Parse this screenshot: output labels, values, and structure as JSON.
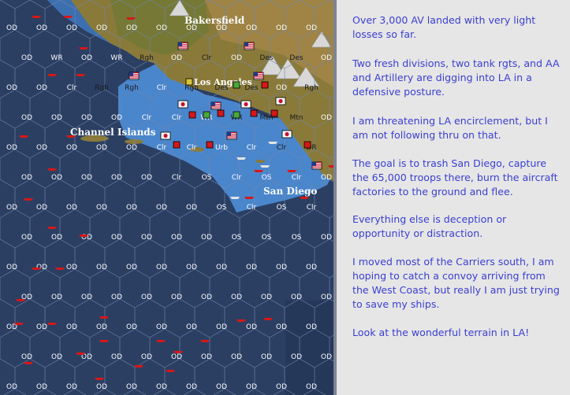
{
  "map": {
    "cities": {
      "bakersfield": "Bakersfield",
      "los_angeles": "Los Angeles",
      "channel_islands": "Channel Islands",
      "san_diego": "San Diego"
    },
    "terrain_codes": {
      "ocean_deep": "OD",
      "ocean_shallow": "OS",
      "clear": "Clr",
      "rough": "Rgh",
      "desert": "Des",
      "woods_rough": "WR",
      "mountain": "Mtn",
      "urban": "Urb",
      "dry": "DR"
    },
    "colors": {
      "ocean_deep": "#2b3f63",
      "ocean_shallow": "#4a86cc",
      "land": "#8a7a3a",
      "mountain": "#c9c9c9",
      "red_unit": "#d41818",
      "panel_text": "#3a3fd0"
    }
  },
  "panel": {
    "paragraphs": [
      "Over 3,000 AV landed with very light losses so far.",
      "Two fresh divisions, two tank rgts, and AA and Artillery are digging into LA in a defensive posture.",
      "I am threatening LA encirclement, but I am not following thru on that.",
      "The goal is to trash San Diego, capture the 65,000 troops there, burn the aircraft factories to the ground and flee.",
      "Everything else is deception or opportunity or distraction.",
      "I moved most of the Carriers south, I am hoping to catch a convoy arriving from the West Coast, but really I am just trying to save my ships.",
      "Look at the wonderful terrain in LA!"
    ]
  }
}
